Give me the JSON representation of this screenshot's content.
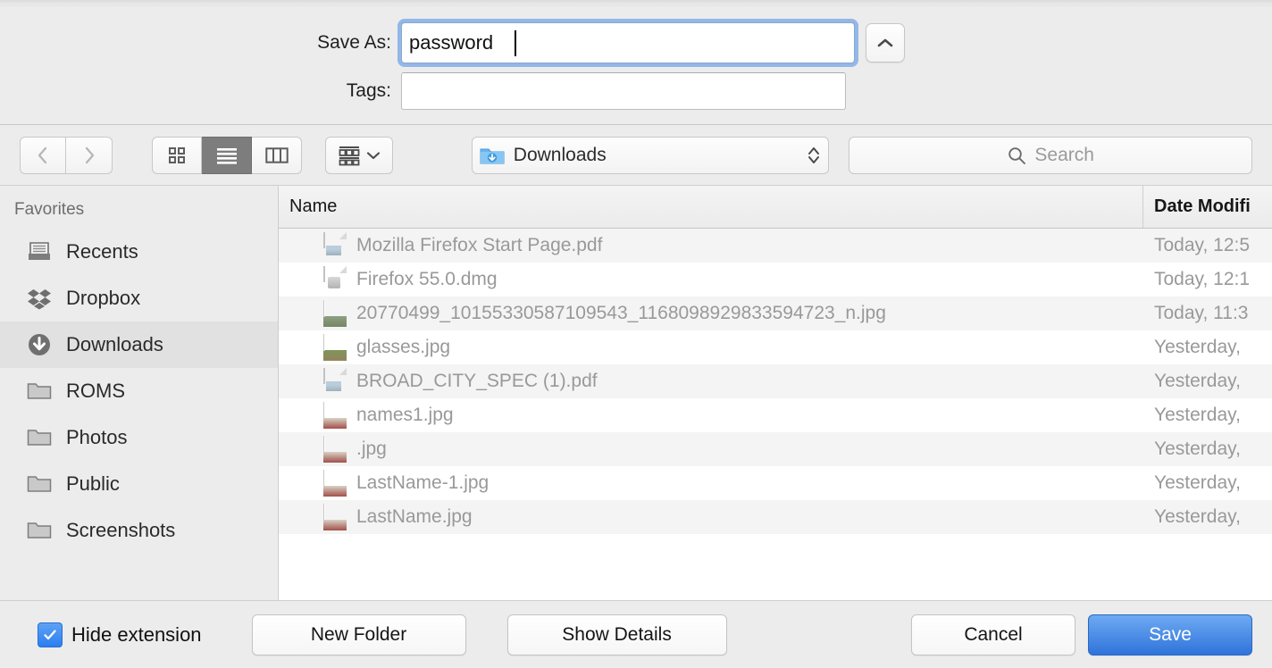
{
  "header": {
    "save_as_label": "Save As:",
    "save_as_value": "password",
    "tags_label": "Tags:",
    "tags_value": "",
    "tags_placeholder": "",
    "collapse_button_icon": "chevron-up-icon"
  },
  "toolbar": {
    "back_icon": "chevron-left-icon",
    "forward_icon": "chevron-right-icon",
    "view_icon_grid": "grid-view-icon",
    "view_list": "list-view-icon",
    "view_column": "column-view-icon",
    "arrange_icon": "arrange-items-icon",
    "arrange_chevron": "chevron-down-icon",
    "path_label": "Downloads",
    "path_icon": "downloads-folder-icon",
    "path_stepper_icon": "up-down-stepper-icon",
    "search_icon": "search-icon",
    "search_placeholder": "Search",
    "search_value": ""
  },
  "sidebar": {
    "section_title": "Favorites",
    "items": [
      {
        "label": "Recents",
        "icon": "recents-tray-icon",
        "selected": false
      },
      {
        "label": "Dropbox",
        "icon": "dropbox-icon",
        "selected": false
      },
      {
        "label": "Downloads",
        "icon": "downloads-circle-icon",
        "selected": true
      },
      {
        "label": "ROMS",
        "icon": "folder-icon",
        "selected": false
      },
      {
        "label": "Photos",
        "icon": "folder-icon",
        "selected": false
      },
      {
        "label": "Public",
        "icon": "folder-icon",
        "selected": false
      },
      {
        "label": "Screenshots",
        "icon": "folder-icon",
        "selected": false
      }
    ]
  },
  "filelist": {
    "columns": {
      "name": "Name",
      "date_modified": "Date Modifi"
    },
    "rows": [
      {
        "name": "Mozilla Firefox Start Page.pdf",
        "date": "Today, 12:5",
        "icon": "pdf-file-icon"
      },
      {
        "name": "Firefox 55.0.dmg",
        "date": "Today, 12:1",
        "icon": "dmg-file-icon"
      },
      {
        "name": "20770499_10155330587109543_1168098929833594723_n.jpg",
        "date": "Today, 11:3",
        "icon": "image-thumbnail-tree"
      },
      {
        "name": "glasses.jpg",
        "date": "Yesterday,",
        "icon": "image-thumbnail-girl"
      },
      {
        "name": "BROAD_CITY_SPEC (1).pdf",
        "date": "Yesterday,",
        "icon": "pdf-file-icon"
      },
      {
        "name": "names1.jpg",
        "date": "Yesterday,",
        "icon": "image-thumbnail-paper"
      },
      {
        "name": " .jpg",
        "date": "Yesterday,",
        "icon": "image-thumbnail-paper"
      },
      {
        "name": "LastName-1.jpg",
        "date": "Yesterday,",
        "icon": "image-thumbnail-paper"
      },
      {
        "name": "LastName.jpg",
        "date": "Yesterday,",
        "icon": "image-thumbnail-paper"
      }
    ]
  },
  "bottom": {
    "hide_extension_label": "Hide extension",
    "hide_extension_checked": true,
    "new_folder_label": "New Folder",
    "show_details_label": "Show Details",
    "cancel_label": "Cancel",
    "save_label": "Save"
  },
  "colors": {
    "accent": "#2f74db",
    "focus_ring": "#82aee7",
    "window_bg": "#ececec",
    "row_alt": "#f4f4f4",
    "text_muted": "#999999"
  }
}
